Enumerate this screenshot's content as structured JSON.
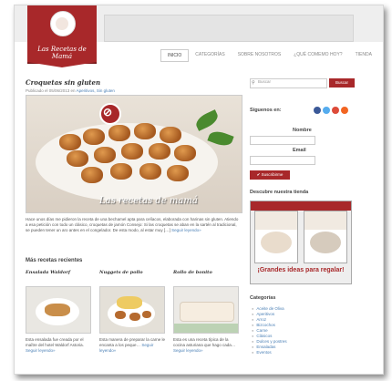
{
  "header": {
    "site_title": "Las Recetas de Mamá"
  },
  "nav": {
    "items": [
      "INICIO",
      "CATEGORÍAS",
      "SOBRE NOSOTROS",
      "¿QUÉ COMEMO HOY?",
      "TIENDA"
    ],
    "active": "INICIO"
  },
  "post": {
    "title": "Croquetas sin gluten",
    "meta_prefix": "Publicado el 05/06/2013 en",
    "meta_links": "Aperitivos, Sin gluten",
    "image_watermark": "Las recetas de mamá",
    "excerpt": "Hace unos días me pidieron la receta de una bechamel apta para celíacos, elaborada con harinas sin gluten. Atiendo a esa petición con todo un clásico, croquetas de jamón Consejo: Si las croquetas se aban en la sartén al tradicional, se pueden tener un aro antes en el congelador. De esta modo, al estar muy […]",
    "read_more": "Seguir leyendo»"
  },
  "recent": {
    "title": "Más recetas recientes",
    "items": [
      {
        "title": "Ensalada Waldorf",
        "text": "Esta ensalada fue creada por el maître del hotel Waldorf Astoria.",
        "link": "Seguir leyendo»"
      },
      {
        "title": "Nuggets de pollo",
        "text": "Esta manera de preparar la carne le encanta a los peque…",
        "link": "Seguir leyendo»"
      },
      {
        "title": "Rollo de bonito",
        "text": "Esta es una receta típica de la cocina asturiana que hago cada…",
        "link": "Seguir leyendo»"
      }
    ]
  },
  "sidebar": {
    "search_placeholder": "Buscar",
    "search_button": "Buscar",
    "follow_label": "Síguenos en:",
    "name_label": "Nombre",
    "email_label": "Email",
    "subscribe_button": "Suscribirme",
    "shop_title": "Descubre nuestra tienda",
    "shop_slogan": "¡Grandes ideas para regalar!",
    "categories_title": "Categorías",
    "categories": [
      "Aceite de Oliva",
      "Aperitivos",
      "Arroz",
      "Bizcochos",
      "Carne",
      "Clásicos",
      "Dulces y postres",
      "Ensaladas",
      "Eventos"
    ]
  },
  "colors": {
    "brand_red": "#a8282a",
    "link_blue": "#4a7fb5"
  }
}
